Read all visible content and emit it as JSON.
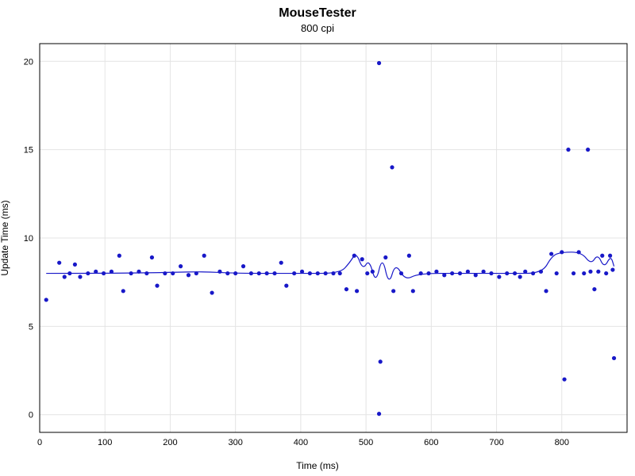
{
  "chart_data": {
    "type": "scatter",
    "title": "MouseTester",
    "subtitle": "800 cpi",
    "xlabel": "Time (ms)",
    "ylabel": "Update Time (ms)",
    "xlim": [
      0,
      900
    ],
    "ylim": [
      -1,
      21
    ],
    "xticks": [
      0,
      100,
      200,
      300,
      400,
      500,
      600,
      700,
      800
    ],
    "yticks": [
      0,
      5,
      10,
      15,
      20
    ],
    "point_color": "#1818c8",
    "series": [
      {
        "name": "Update Time",
        "points": [
          {
            "x": 10,
            "y": 6.5
          },
          {
            "x": 30,
            "y": 8.6
          },
          {
            "x": 38,
            "y": 7.8
          },
          {
            "x": 46,
            "y": 8.0
          },
          {
            "x": 54,
            "y": 8.5
          },
          {
            "x": 62,
            "y": 7.8
          },
          {
            "x": 74,
            "y": 8.0
          },
          {
            "x": 86,
            "y": 8.1
          },
          {
            "x": 98,
            "y": 8.0
          },
          {
            "x": 110,
            "y": 8.1
          },
          {
            "x": 122,
            "y": 9.0
          },
          {
            "x": 128,
            "y": 7.0
          },
          {
            "x": 140,
            "y": 8.0
          },
          {
            "x": 152,
            "y": 8.1
          },
          {
            "x": 164,
            "y": 8.0
          },
          {
            "x": 172,
            "y": 8.9
          },
          {
            "x": 180,
            "y": 7.3
          },
          {
            "x": 192,
            "y": 8.0
          },
          {
            "x": 204,
            "y": 8.0
          },
          {
            "x": 216,
            "y": 8.4
          },
          {
            "x": 228,
            "y": 7.9
          },
          {
            "x": 240,
            "y": 8.0
          },
          {
            "x": 252,
            "y": 9.0
          },
          {
            "x": 264,
            "y": 6.9
          },
          {
            "x": 276,
            "y": 8.1
          },
          {
            "x": 288,
            "y": 8.0
          },
          {
            "x": 300,
            "y": 8.0
          },
          {
            "x": 312,
            "y": 8.4
          },
          {
            "x": 324,
            "y": 8.0
          },
          {
            "x": 336,
            "y": 8.0
          },
          {
            "x": 348,
            "y": 8.0
          },
          {
            "x": 360,
            "y": 8.0
          },
          {
            "x": 370,
            "y": 8.6
          },
          {
            "x": 378,
            "y": 7.3
          },
          {
            "x": 390,
            "y": 8.0
          },
          {
            "x": 402,
            "y": 8.1
          },
          {
            "x": 414,
            "y": 8.0
          },
          {
            "x": 426,
            "y": 8.0
          },
          {
            "x": 438,
            "y": 8.0
          },
          {
            "x": 450,
            "y": 8.0
          },
          {
            "x": 460,
            "y": 8.0
          },
          {
            "x": 470,
            "y": 7.1
          },
          {
            "x": 482,
            "y": 9.0
          },
          {
            "x": 486,
            "y": 7.0
          },
          {
            "x": 494,
            "y": 8.8
          },
          {
            "x": 502,
            "y": 8.0
          },
          {
            "x": 510,
            "y": 8.1
          },
          {
            "x": 520,
            "y": 19.9
          },
          {
            "x": 520,
            "y": 0.05
          },
          {
            "x": 522,
            "y": 3.0
          },
          {
            "x": 530,
            "y": 8.9
          },
          {
            "x": 540,
            "y": 14.0
          },
          {
            "x": 542,
            "y": 7.0
          },
          {
            "x": 554,
            "y": 8.0
          },
          {
            "x": 566,
            "y": 9.0
          },
          {
            "x": 572,
            "y": 7.0
          },
          {
            "x": 584,
            "y": 8.0
          },
          {
            "x": 596,
            "y": 8.0
          },
          {
            "x": 608,
            "y": 8.1
          },
          {
            "x": 620,
            "y": 7.9
          },
          {
            "x": 632,
            "y": 8.0
          },
          {
            "x": 644,
            "y": 8.0
          },
          {
            "x": 656,
            "y": 8.1
          },
          {
            "x": 668,
            "y": 7.9
          },
          {
            "x": 680,
            "y": 8.1
          },
          {
            "x": 692,
            "y": 8.0
          },
          {
            "x": 704,
            "y": 7.8
          },
          {
            "x": 716,
            "y": 8.0
          },
          {
            "x": 728,
            "y": 8.0
          },
          {
            "x": 736,
            "y": 7.8
          },
          {
            "x": 744,
            "y": 8.1
          },
          {
            "x": 756,
            "y": 8.0
          },
          {
            "x": 768,
            "y": 8.1
          },
          {
            "x": 776,
            "y": 7.0
          },
          {
            "x": 784,
            "y": 9.1
          },
          {
            "x": 792,
            "y": 8.0
          },
          {
            "x": 800,
            "y": 9.2
          },
          {
            "x": 804,
            "y": 2.0
          },
          {
            "x": 810,
            "y": 15.0
          },
          {
            "x": 818,
            "y": 8.0
          },
          {
            "x": 826,
            "y": 9.2
          },
          {
            "x": 834,
            "y": 8.0
          },
          {
            "x": 840,
            "y": 15.0
          },
          {
            "x": 844,
            "y": 8.1
          },
          {
            "x": 850,
            "y": 7.1
          },
          {
            "x": 856,
            "y": 8.1
          },
          {
            "x": 862,
            "y": 9.0
          },
          {
            "x": 868,
            "y": 8.0
          },
          {
            "x": 874,
            "y": 9.0
          },
          {
            "x": 878,
            "y": 8.2
          },
          {
            "x": 880,
            "y": 3.2
          }
        ]
      }
    ],
    "trend_line": [
      {
        "x": 10,
        "y": 8.0
      },
      {
        "x": 100,
        "y": 8.0
      },
      {
        "x": 200,
        "y": 8.05
      },
      {
        "x": 250,
        "y": 8.1
      },
      {
        "x": 300,
        "y": 8.0
      },
      {
        "x": 400,
        "y": 8.0
      },
      {
        "x": 460,
        "y": 8.0
      },
      {
        "x": 475,
        "y": 8.6
      },
      {
        "x": 485,
        "y": 9.2
      },
      {
        "x": 495,
        "y": 8.2
      },
      {
        "x": 505,
        "y": 8.8
      },
      {
        "x": 515,
        "y": 7.4
      },
      {
        "x": 525,
        "y": 9.0
      },
      {
        "x": 535,
        "y": 7.3
      },
      {
        "x": 545,
        "y": 8.6
      },
      {
        "x": 560,
        "y": 7.6
      },
      {
        "x": 580,
        "y": 8.0
      },
      {
        "x": 650,
        "y": 8.0
      },
      {
        "x": 720,
        "y": 8.0
      },
      {
        "x": 770,
        "y": 8.0
      },
      {
        "x": 785,
        "y": 9.0
      },
      {
        "x": 800,
        "y": 9.2
      },
      {
        "x": 830,
        "y": 9.2
      },
      {
        "x": 845,
        "y": 8.5
      },
      {
        "x": 855,
        "y": 9.1
      },
      {
        "x": 865,
        "y": 8.3
      },
      {
        "x": 875,
        "y": 9.0
      },
      {
        "x": 880,
        "y": 8.4
      }
    ]
  }
}
